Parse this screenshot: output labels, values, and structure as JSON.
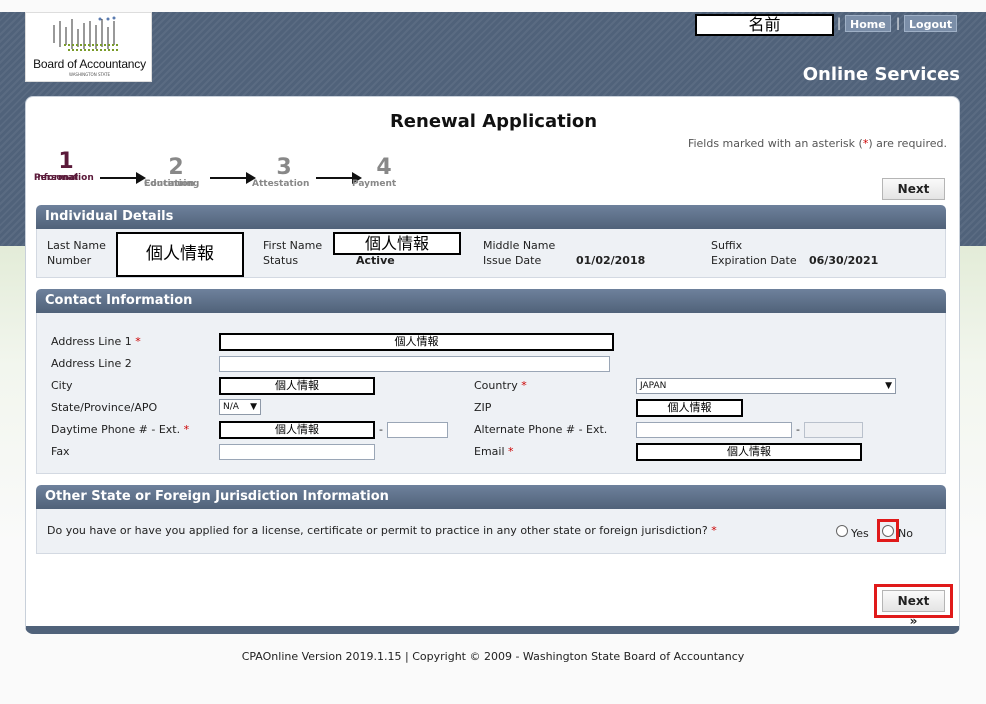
{
  "header": {
    "logo_text": "Board of Accountancy",
    "logo_subtext": "WASHINGTON STATE",
    "username": "名前",
    "home_label": "Home",
    "logout_label": "Logout",
    "separator": "|",
    "online_services": "Online Services"
  },
  "page": {
    "title": "Renewal Application",
    "required_note_prefix": "Fields marked with an asterisk (",
    "required_note_ast": "*",
    "required_note_suffix": ") are required.",
    "next_label": "Next »"
  },
  "steps": [
    {
      "num": "1",
      "label_line1": "Personal",
      "label_line2": "Information",
      "active": true
    },
    {
      "num": "2",
      "label_line1": "Continuing",
      "label_line2": "Education",
      "active": false
    },
    {
      "num": "3",
      "label_line1": "Attestation",
      "label_line2": "",
      "active": false
    },
    {
      "num": "4",
      "label_line1": "Payment",
      "label_line2": "",
      "active": false
    }
  ],
  "individual": {
    "heading": "Individual Details",
    "last_name_label": "Last Name",
    "number_label": "Number",
    "redacted_text": "個人情報",
    "first_name_label": "First Name",
    "status_label": "Status",
    "status_value": "Active",
    "middle_name_label": "Middle Name",
    "issue_date_label": "Issue Date",
    "issue_date_value": "01/02/2018",
    "suffix_label": "Suffix",
    "expiration_label": "Expiration Date",
    "expiration_value": "06/30/2021"
  },
  "contact": {
    "heading": "Contact Information",
    "address1_label": "Address Line 1",
    "address2_label": "Address Line 2",
    "city_label": "City",
    "state_label": "State/Province/APO",
    "state_value": "N/A",
    "daytime_label": "Daytime Phone # - Ext.",
    "fax_label": "Fax",
    "country_label": "Country",
    "country_value": "JAPAN",
    "zip_label": "ZIP",
    "alt_phone_label": "Alternate Phone # - Ext.",
    "email_label": "Email",
    "dash": "-",
    "asterisk": "*",
    "redacted_text": "個人情報"
  },
  "jurisdiction": {
    "heading": "Other State or Foreign Jurisdiction Information",
    "question": "Do you have or have you applied for a license, certificate or permit to practice in any other state or foreign jurisdiction?",
    "asterisk": "*",
    "yes_label": "Yes",
    "no_label": "No"
  },
  "footer": {
    "text": "CPAOnline Version 2019.1.15 | Copyright © 2009 - Washington State Board of Accountancy"
  }
}
